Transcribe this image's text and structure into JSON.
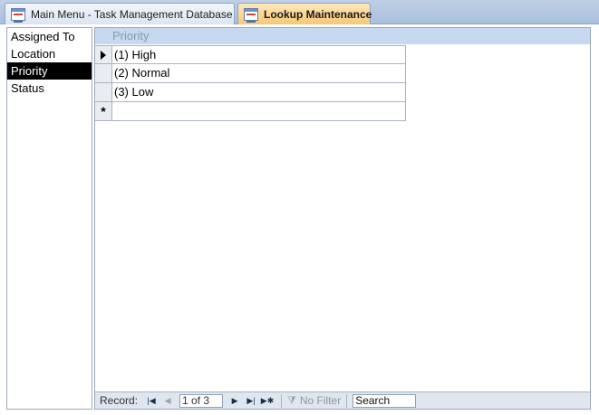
{
  "tabs": [
    {
      "label": "Main Menu - Task Management Database",
      "active": false
    },
    {
      "label": "Lookup Maintenance",
      "active": true
    }
  ],
  "lookup_list": {
    "items": [
      "Assigned To",
      "Location",
      "Priority",
      "Status"
    ],
    "selected": "Priority"
  },
  "subform": {
    "column_header": "Priority",
    "rows": [
      "(1) High",
      "(2) Normal",
      "(3) Low"
    ],
    "new_record_marker": "*"
  },
  "navigation": {
    "record_label": "Record:",
    "position": "1 of 3",
    "filter_label": "No Filter",
    "search_label": "Search"
  },
  "colors": {
    "active_tab": "#f8c776",
    "header_band": "#c6d9f1",
    "selected_item": "#000000"
  }
}
